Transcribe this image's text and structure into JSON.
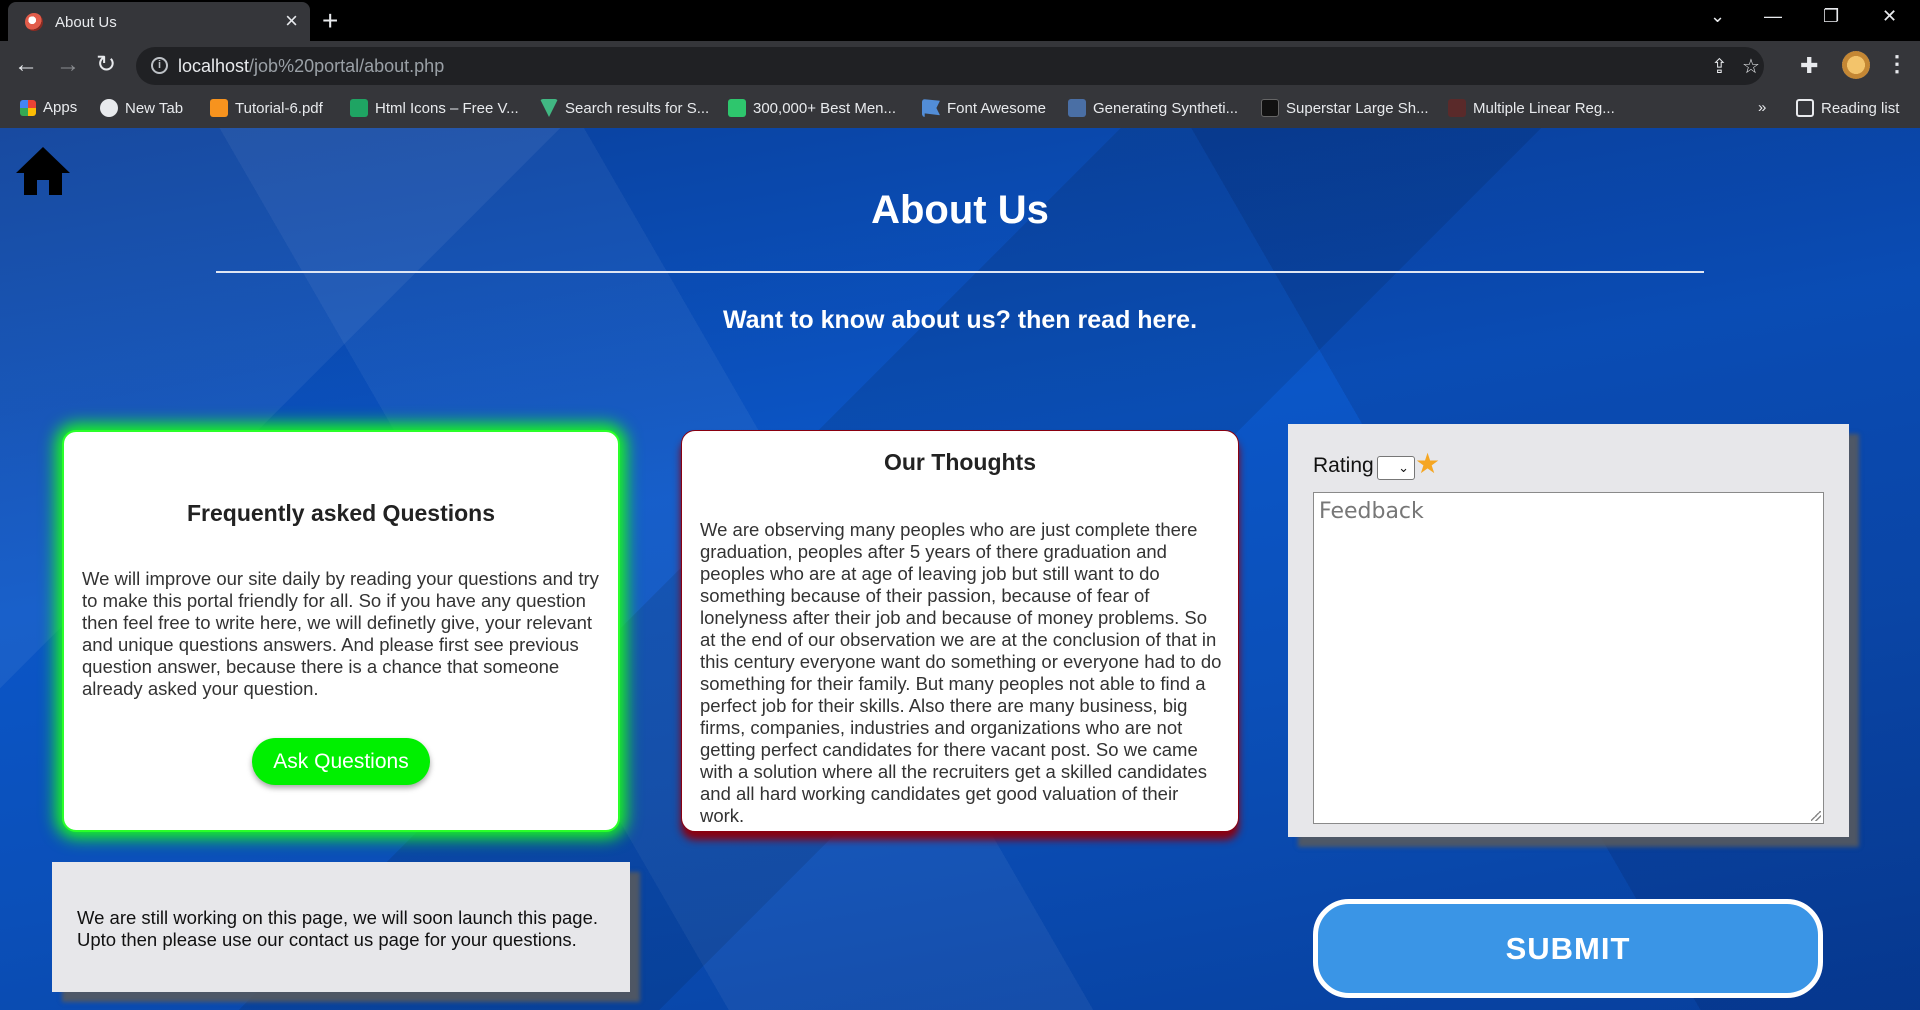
{
  "browser": {
    "tab_title": "About Us",
    "tab_close": "×",
    "new_tab": "+",
    "url_host": "localhost",
    "url_path": "/job%20portal/about.php",
    "window_controls": [
      "⌄",
      "—",
      "❐",
      "✕"
    ],
    "bookmarks": [
      {
        "label": "Apps",
        "icon": "apps-grid-icon",
        "color": "#e8453c"
      },
      {
        "label": "New Tab",
        "icon": "globe-icon",
        "color": "#e8eaed"
      },
      {
        "label": "Tutorial-6.pdf",
        "icon": "moodle-icon",
        "color": "#f7931e"
      },
      {
        "label": "Html Icons – Free V...",
        "icon": "green-square-icon",
        "color": "#1fa463"
      },
      {
        "label": "Search results for S...",
        "icon": "vue-icon",
        "color": "#41b883"
      },
      {
        "label": "300,000+ Best Men...",
        "icon": "pixabay-icon",
        "color": "#2ec66d"
      },
      {
        "label": "Font Awesome",
        "icon": "flag-icon",
        "color": "#528dd7"
      },
      {
        "label": "Generating Syntheti...",
        "icon": "sds-icon",
        "color": "#4a6fa5"
      },
      {
        "label": "Superstar Large Sh...",
        "icon": "dark-square-icon",
        "color": "#111111"
      },
      {
        "label": "Multiple Linear Reg...",
        "icon": "sa-icon",
        "color": "#d34b4b"
      }
    ],
    "overflow": "»",
    "reading_list": "Reading list"
  },
  "page": {
    "title": "About Us",
    "subtitle": "Want to know about us? then read here.",
    "faq": {
      "heading": "Frequently asked Questions",
      "body": "We will improve our site daily by reading your questions and try to make this portal friendly for all. So if you have any question then feel free to write here, we will definetly give, your relevant and unique questions answers. And please first see previous question answer, because there is a chance that someone already asked your question.",
      "button": "Ask Questions"
    },
    "thoughts": {
      "heading": "Our Thoughts",
      "body": "We are observing many peoples who are just complete there graduation, peoples after 5 years of there graduation and peoples who are at age of leaving job but still want to do something because of their passion, because of fear of lonelyness after their job and because of money problems. So at the end of our observation we are at the conclusion of that in this century everyone want do something or everyone had to do something for their family. But many peoples not able to find a perfect job for their skills. Also there are many business, big firms, companies, industries and organizations who are not getting perfect candidates for there vacant post. So we came with a solution where all the recruiters get a skilled candidates and all hard working candidates get good valuation of their work."
    },
    "notice": "We are still working on this page, we will soon launch this page. Upto then please use our contact us page for your questions.",
    "feedback": {
      "rating_label": "Rating",
      "rating_value": "",
      "placeholder": "Feedback"
    },
    "submit": "SUBMIT"
  }
}
